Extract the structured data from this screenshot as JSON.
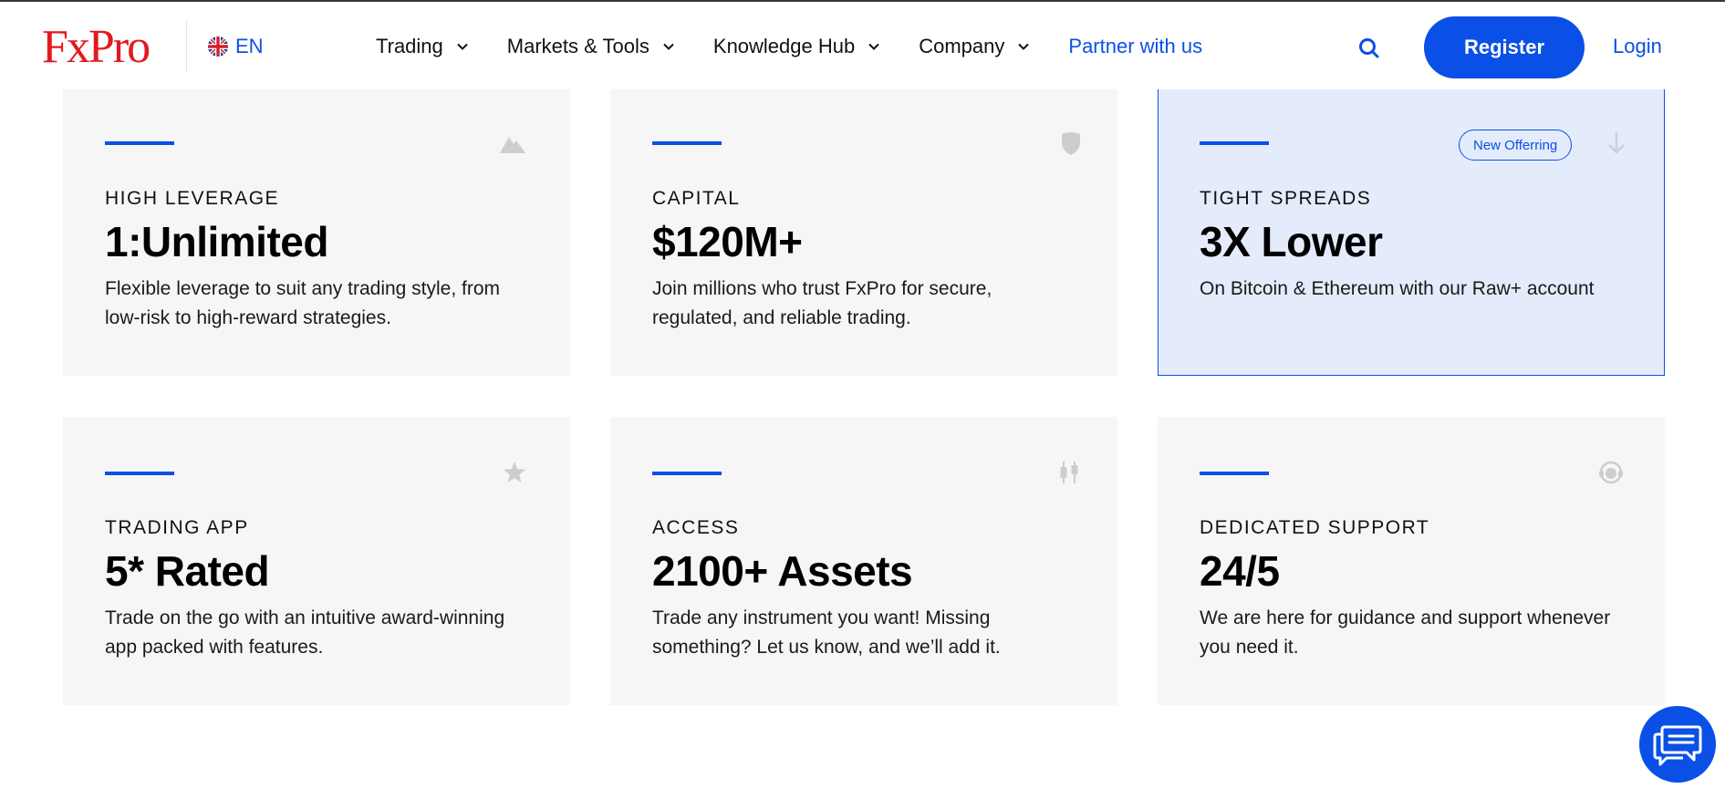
{
  "header": {
    "logo": "FxPro",
    "language": "EN",
    "nav": [
      {
        "label": "Trading",
        "has_dropdown": true
      },
      {
        "label": "Markets & Tools",
        "has_dropdown": true
      },
      {
        "label": "Knowledge Hub",
        "has_dropdown": true
      },
      {
        "label": "Company",
        "has_dropdown": true
      },
      {
        "label": "Partner with us",
        "has_dropdown": false
      }
    ],
    "search_icon": "search-icon",
    "register_label": "Register",
    "login_label": "Login"
  },
  "cards": [
    {
      "eyebrow": "HIGH LEVERAGE",
      "headline": "1:Unlimited",
      "description": "Flexible leverage to suit any trading style, from low-risk to high-reward strategies.",
      "icon": "mountain-icon"
    },
    {
      "eyebrow": "CAPITAL",
      "headline": "$120M+",
      "description": "Join millions who trust FxPro for secure, regulated, and reliable trading.",
      "icon": "shield-icon"
    },
    {
      "eyebrow": "TIGHT SPREADS",
      "headline": "3X Lower",
      "description": "On Bitcoin & Ethereum with our Raw+ account",
      "icon": "arrow-down-icon",
      "badge": "New Offerring"
    },
    {
      "eyebrow": "TRADING APP",
      "headline": "5* Rated",
      "description": "Trade on the go with an intuitive award-winning app packed with features.",
      "icon": "star-icon"
    },
    {
      "eyebrow": "ACCESS",
      "headline": "2100+ Assets",
      "description": "Trade any instrument you want! Missing something? Let us know, and we’ll add it.",
      "icon": "candlestick-icon"
    },
    {
      "eyebrow": "DEDICATED SUPPORT",
      "headline": "24/5",
      "description": "We are here for guidance and support whenever you need it.",
      "icon": "support-agent-icon"
    }
  ],
  "colors": {
    "brand_red": "#e3191f",
    "accent_blue": "#0a50e6",
    "card_bg": "#f6f6f6",
    "highlight_bg": "#e4ecfc"
  },
  "chat_icon": "chat-icon"
}
